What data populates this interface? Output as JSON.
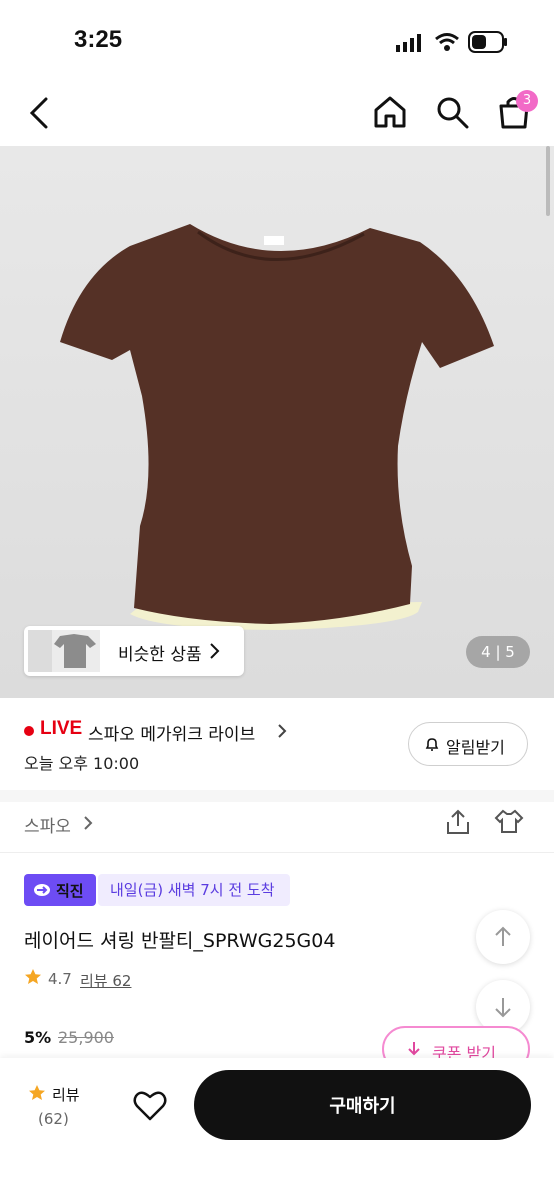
{
  "status_bar": {
    "time": "3:25"
  },
  "header": {
    "cart_count": "3"
  },
  "hero": {
    "similar_label": "비슷한 상품",
    "pager": "4 | 5"
  },
  "live": {
    "tag": "LIVE",
    "title": "스파오 메가위크 라이브",
    "time": "오늘 오후 10:00",
    "alarm_label": "알림받기"
  },
  "brand": {
    "name": "스파오"
  },
  "badges": {
    "direct": "직진",
    "delivery": "내일(금) 새벽 7시 전 도착"
  },
  "product": {
    "title": "레이어드 셔링 반팔티_SPRWG25G04",
    "rating": "4.7",
    "review_link": "리뷰 62",
    "discount": "5%",
    "original_price": "25,900",
    "coupon_label": "쿠폰 받기"
  },
  "bottom": {
    "review_label": "리뷰",
    "review_count": "(62)",
    "buy_label": "구매하기"
  },
  "colors": {
    "accent_purple": "#6d4cf4",
    "live_red": "#e60012",
    "coupon_pink": "#f58ad1",
    "product_brown": "#5a2d24"
  }
}
